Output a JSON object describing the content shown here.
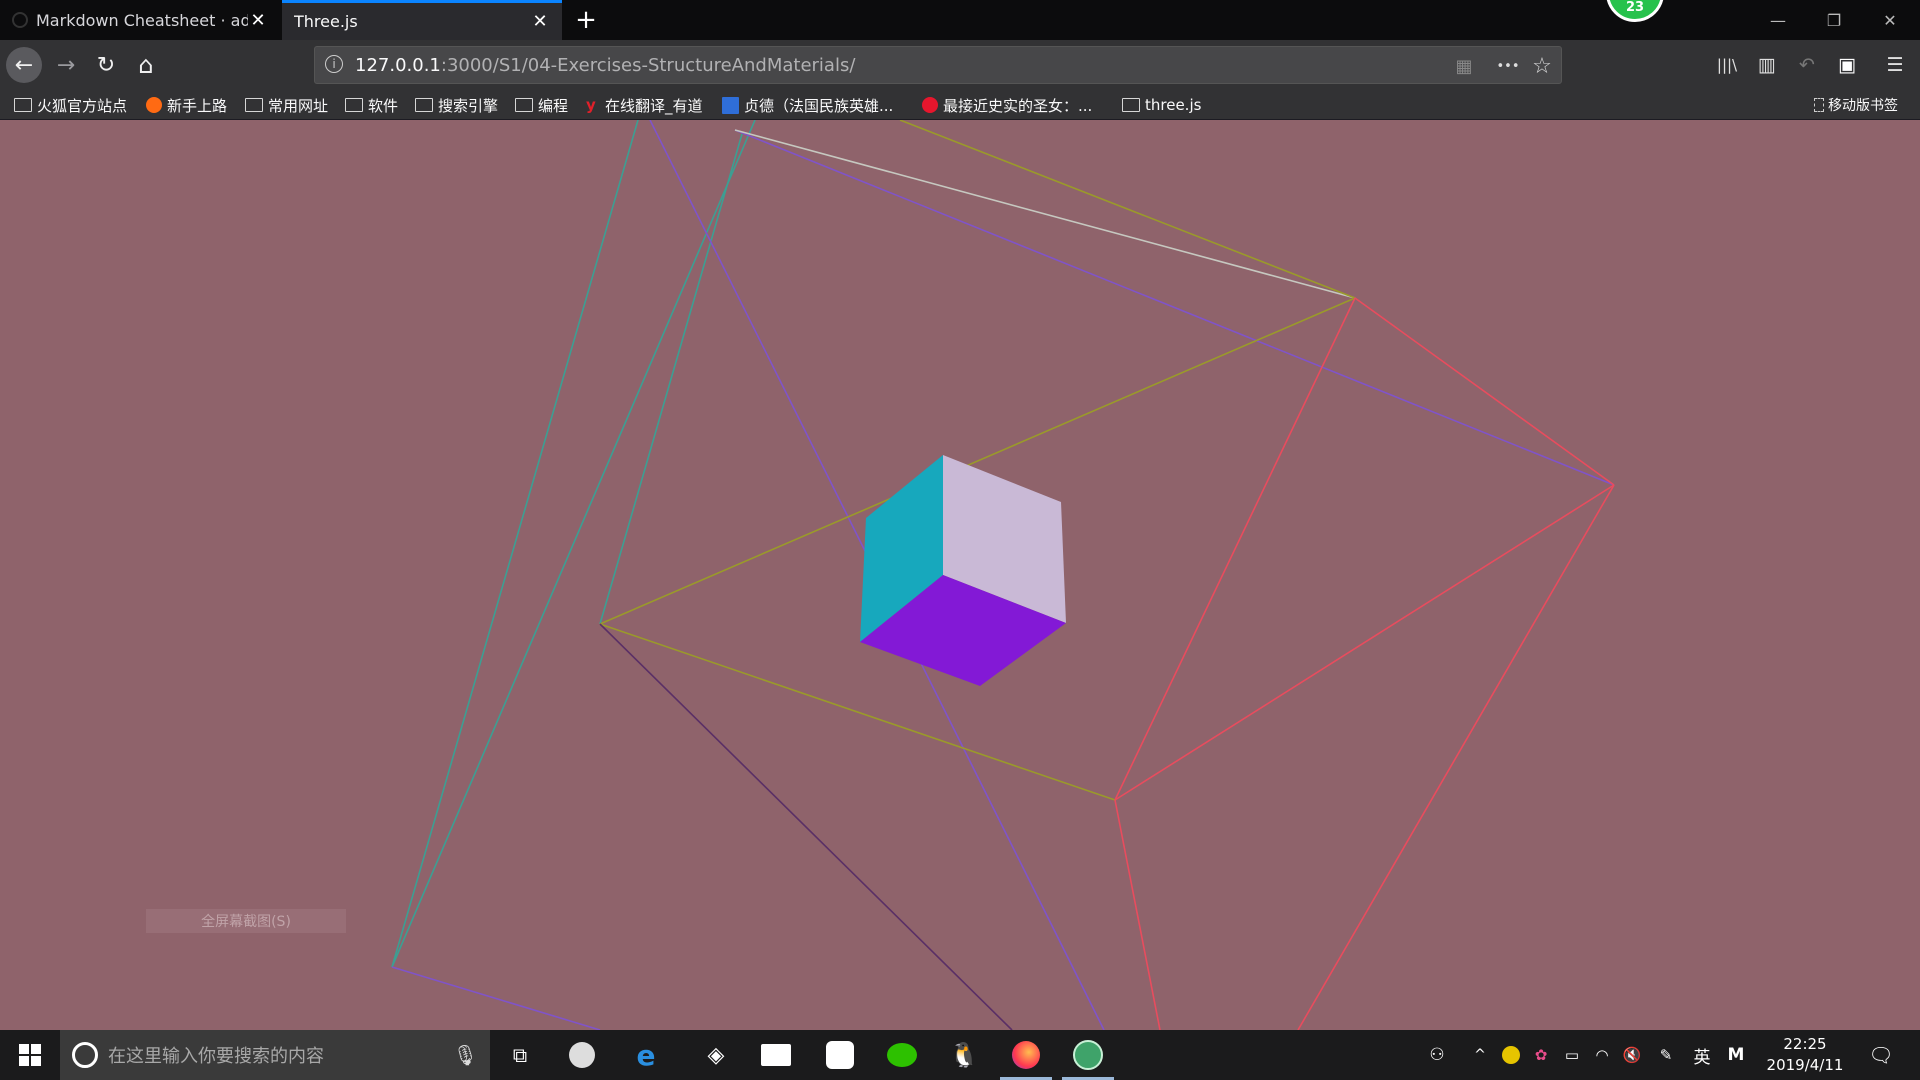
{
  "tabs": [
    {
      "label": "Markdown Cheatsheet · adam-p/markdown-here Wiki",
      "close": "✕"
    },
    {
      "label": "Three.js",
      "close": "✕"
    }
  ],
  "new_tab": "+",
  "account_badge": "23",
  "window_controls": {
    "minimize": "—",
    "restore": "❐",
    "close": "✕"
  },
  "nav": {
    "back": "←",
    "forward": "→",
    "reload": "↻",
    "home": "⌂"
  },
  "url": {
    "host": "127.0.0.1",
    "rest": ":3000/S1/04-Exercises-StructureAndMaterials/"
  },
  "url_icons": {
    "info": "i",
    "qr": "▦",
    "more": "•••",
    "star": "☆"
  },
  "toolbar_icons": {
    "library": "|||\\",
    "sidebar": "▥",
    "undo": "↶",
    "pocket": "▣",
    "menu": "☰"
  },
  "bookmarks": [
    {
      "label": "火狐官方站点",
      "icon": "folder-icon"
    },
    {
      "label": "新手上路",
      "icon": "firefox-icon"
    },
    {
      "label": "常用网址",
      "icon": "folder-icon"
    },
    {
      "label": "软件",
      "icon": "folder-icon"
    },
    {
      "label": "搜索引擎",
      "icon": "folder-icon"
    },
    {
      "label": "编程",
      "icon": "folder-icon"
    },
    {
      "label": "在线翻译_有道",
      "icon": "youdao-icon"
    },
    {
      "label": "贞德（法国民族英雄...",
      "icon": "baidu-icon"
    },
    {
      "label": "最接近史实的圣女：...",
      "icon": "weibo-icon"
    },
    {
      "label": "three.js",
      "icon": "folder-icon"
    }
  ],
  "mobile_bookmarks": "移动版书签",
  "context_tip": "全屏幕截图(S)",
  "scene": {
    "background": "#8f636b",
    "cube_colors": {
      "left": "#17a8bd",
      "right": "#c9b9d6",
      "bottom": "#8319d6"
    }
  },
  "taskbar": {
    "search_placeholder": "在这里输入你要搜索的内容",
    "lang": "英",
    "ime": "M",
    "time": "22:25",
    "date": "2019/4/11"
  }
}
